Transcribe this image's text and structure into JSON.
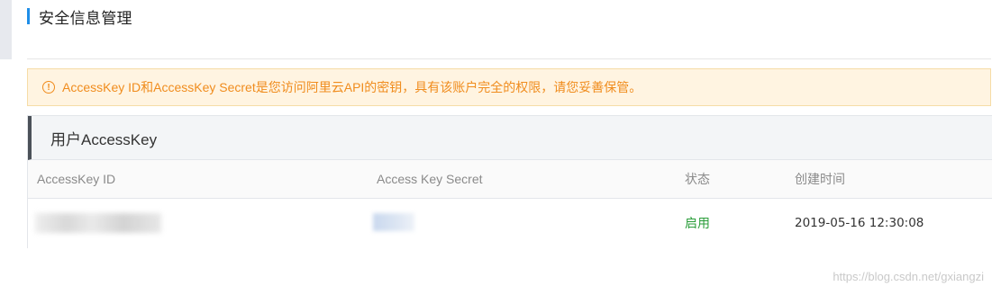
{
  "page": {
    "title": "安全信息管理"
  },
  "alert": {
    "icon": "exclamation-circle-icon",
    "text": "AccessKey ID和AccessKey Secret是您访问阿里云API的密钥，具有该账户完全的权限，请您妥善保管。",
    "color": "#f08c1d"
  },
  "panel": {
    "title": "用户AccessKey",
    "columns": [
      "AccessKey ID",
      "Access Key Secret",
      "状态",
      "创建时间"
    ],
    "rows": [
      {
        "access_key_id": "",
        "access_key_secret": "",
        "status": "启用",
        "created": "2019-05-16 12:30:08"
      }
    ],
    "status_color": "#2a9d3a"
  },
  "watermark": "https://blog.csdn.net/gxiangzi"
}
